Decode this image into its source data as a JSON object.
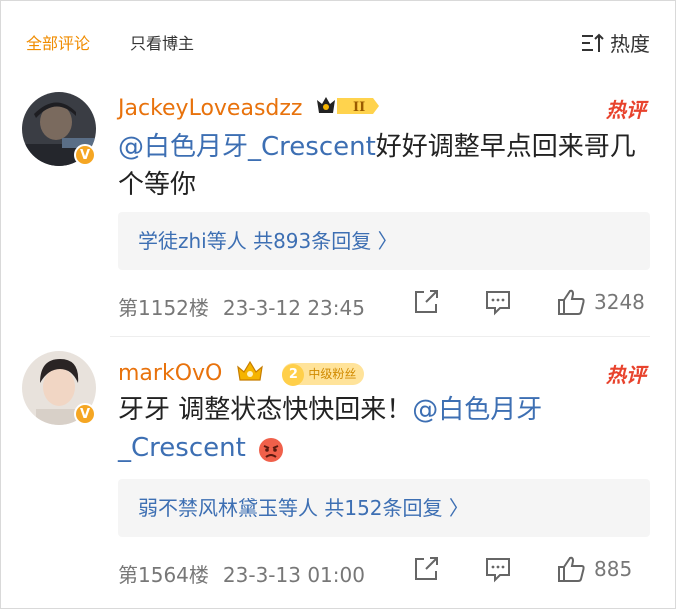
{
  "tabs": {
    "all_comments": "全部评论",
    "blogger_only": "只看博主"
  },
  "sort": {
    "label": "热度",
    "icon": "sort-icon"
  },
  "colors": {
    "accent": "#f08c00",
    "username": "#e8720c",
    "link": "#3d6fb3",
    "hot": "#e8432d"
  },
  "comments": [
    {
      "username": "JackeyLoveasdzz",
      "rank_badge": "II",
      "hot_label": "热评",
      "mention": "@白色月牙_Crescent",
      "text": "好好调整早点回来哥几个等你",
      "replies": "学徒zhi等人  共893条回复 〉",
      "floor": "第1152楼",
      "date": "23-3-12 23:45",
      "likes": "3248"
    },
    {
      "username": "markOvO",
      "fan_level": "2",
      "fan_label": "中级粉丝",
      "hot_label": "热评",
      "text": "牙牙 调整状态快快回来！",
      "mention": "@白色月牙_Crescent",
      "replies": "弱不禁风林黛玉等人  共152条回复 〉",
      "floor": "第1564楼",
      "date": "23-3-13 01:00",
      "likes": "885"
    }
  ]
}
